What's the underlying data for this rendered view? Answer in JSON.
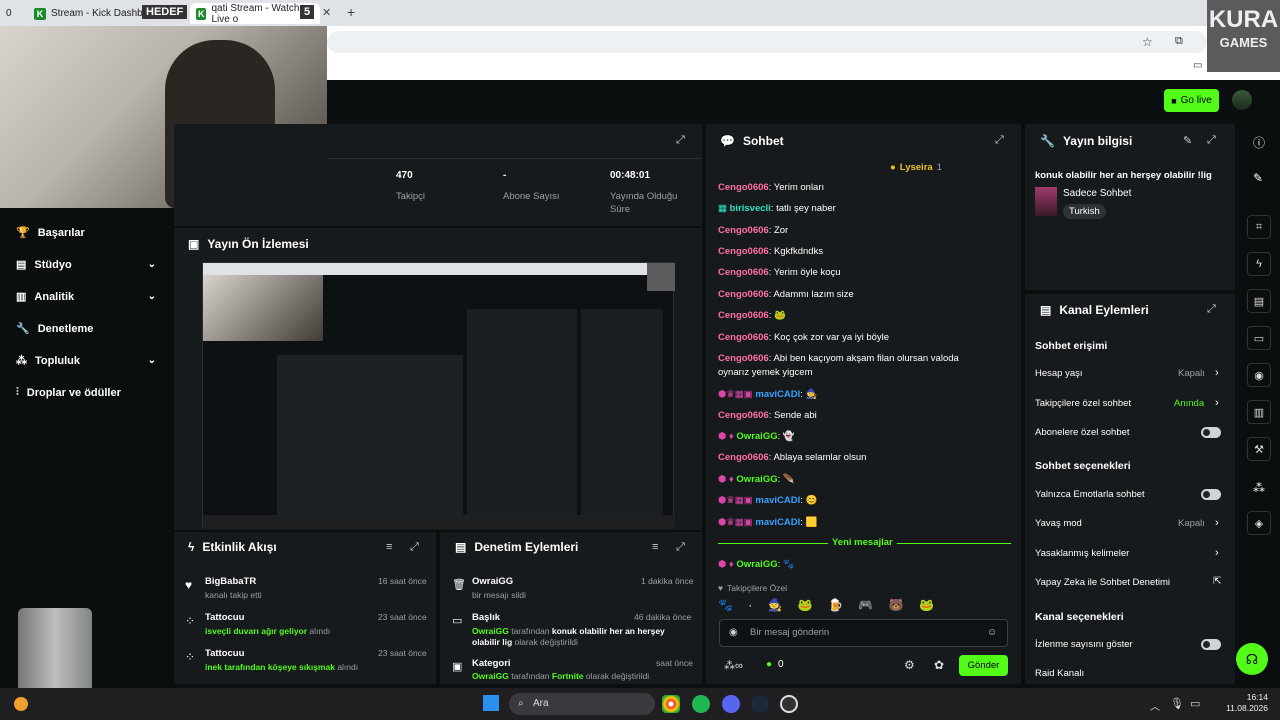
{
  "browser": {
    "tabs": [
      {
        "label": "Stream - Kick Dashboard"
      },
      {
        "label": "qati Stream - Watch Live o"
      }
    ],
    "new_tab": "+",
    "tab_count_left": "0",
    "tab_count_right": "5",
    "overlay_hedef": "HEDEF"
  },
  "watermark": {
    "line1": "KURA",
    "line2": "GAMES"
  },
  "topbar": {
    "go_live": "Go live"
  },
  "sidebar": {
    "items": [
      {
        "label": "Başarılar"
      },
      {
        "label": "Stüdyo"
      },
      {
        "label": "Analitik"
      },
      {
        "label": "Denetleme"
      },
      {
        "label": "Topluluk"
      },
      {
        "label": "Droplar ve ödüller"
      }
    ]
  },
  "stats": {
    "followers_value": "470",
    "followers_label": "Takipçi",
    "subs_value": "-",
    "subs_label": "Abone Sayısı",
    "uptime_value": "00:48:01",
    "uptime_label1": "Yayında Olduğu",
    "uptime_label2": "Süre"
  },
  "preview": {
    "title": "Yayın Ön İzlemesi"
  },
  "activity": {
    "title": "Etkinlik Akışı",
    "items": [
      {
        "user": "BigBabaTR",
        "time": "16 saat önce",
        "desc": "kanalı takip etti",
        "highlight": ""
      },
      {
        "user": "Tattocuu",
        "time": "23 saat önce",
        "highlight": "isveçli duvarı ağır geliyor",
        "desc": "alındı"
      },
      {
        "user": "Tattocuu",
        "time": "23 saat önce",
        "highlight": "inek tarafından köşeye sıkışmak",
        "desc": "alındı"
      }
    ]
  },
  "mod_actions": {
    "title": "Denetim Eylemleri",
    "items": [
      {
        "title": "OwraiGG",
        "time": "1 dakika önce",
        "line1": "bir mesajı sildi",
        "line2": ""
      },
      {
        "title": "Başlık",
        "time": "46 dakika önce",
        "line1a": "OwraiGG",
        "line1b": "tarafından",
        "line1c": "konuk olabilir her an herşey olabilir",
        "line2a": "lig",
        "line2b": "olarak değiştirildi"
      },
      {
        "title": "Kategori",
        "time": "saat önce",
        "line1a": "OwraiGG",
        "line1b": "tarafından",
        "line1c": "Fortnite",
        "line1d": "olarak değiştirildi"
      }
    ]
  },
  "chat": {
    "title": "Sohbet",
    "pinned_user": "Lyseira",
    "pinned_count": "1",
    "messages": [
      {
        "user": "Cengo0606",
        "text": "Yerim onları"
      },
      {
        "user": "birisvecli",
        "text": "tatlı şey naber"
      },
      {
        "user": "Cengo0606",
        "text": "Zor"
      },
      {
        "user": "Cengo0606",
        "text": "Kgkfkdndks"
      },
      {
        "user": "Cengo0606",
        "text": "Yerim öyle koçu"
      },
      {
        "user": "Cengo0606",
        "text": "Adammı lazım size"
      },
      {
        "user": "Cengo0606",
        "text": ""
      },
      {
        "user": "Cengo0606",
        "text": "Koç çok zor var ya iyi böyle"
      },
      {
        "user": "Cengo0606",
        "text": "Abi ben kaçıyom akşam filan olursan valoda"
      },
      {
        "user": "",
        "text": "oynarız yemek yigcem"
      },
      {
        "user": "maviCADI",
        "text": ""
      },
      {
        "user": "Cengo0606",
        "text": "Sende abi"
      },
      {
        "user": "OwraiGG",
        "text": ""
      },
      {
        "user": "Cengo0606",
        "text": "Ablaya selamlar olsun"
      },
      {
        "user": "OwraiGG",
        "text": ""
      },
      {
        "user": "maviCADI",
        "text": ""
      },
      {
        "user": "maviCADI",
        "text": ""
      },
      {
        "user": "OwraiGG",
        "text": ""
      }
    ],
    "new_messages": "Yeni mesajlar",
    "followers_only": "Takipçilere Özel",
    "placeholder": "Bir mesaj gönderin",
    "points": "0",
    "send": "Gönder"
  },
  "stream_info": {
    "title": "Yayın bilgisi",
    "stream_title": "konuk olabilir her an herşey olabilir !lig",
    "category": "Sadece Sohbet",
    "tag": "Turkish"
  },
  "channel_actions": {
    "title": "Kanal Eylemleri",
    "chat_access": "Sohbet erişimi",
    "account_age": "Hesap yaşı",
    "account_age_val": "Kapalı",
    "followers_chat": "Takipçilere özel sohbet",
    "followers_chat_val": "Anında",
    "subs_chat": "Abonelere özel sohbet",
    "chat_options": "Sohbet seçenekleri",
    "emotes_only": "Yalnızca Emotlarla sohbet",
    "slow_mode": "Yavaş mod",
    "slow_mode_val": "Kapalı",
    "banned_words": "Yasaklanmış kelimeler",
    "ai_mod": "Yapay Zeka ile Sohbet Denetimi",
    "channel_options": "Kanal seçenekleri",
    "viewer_count": "İzlenme sayısını göster",
    "raid": "Raid Kanalı"
  },
  "taskbar": {
    "search": "Ara",
    "time": "16:14",
    "date": "11.08.2026"
  }
}
